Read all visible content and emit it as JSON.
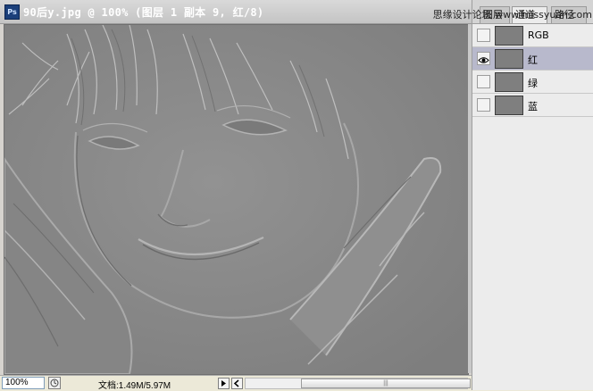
{
  "document": {
    "title": "90后y.jpg @ 100% (图层 1 副本 9, 红/8)",
    "app_icon_label": "Ps"
  },
  "status_bar": {
    "zoom": "100%",
    "doc_info": "文档:1.49M/5.97M"
  },
  "panel": {
    "watermark": "思缘设计论坛 www.missyuan.com",
    "tabs": [
      {
        "label": "图层",
        "active": false
      },
      {
        "label": "通道",
        "active": true
      },
      {
        "label": "路径",
        "active": false
      }
    ],
    "channels": [
      {
        "label": "RGB",
        "visible": false,
        "selected": false
      },
      {
        "label": "红",
        "visible": true,
        "selected": true
      },
      {
        "label": "绿",
        "visible": false,
        "selected": false
      },
      {
        "label": "蓝",
        "visible": false,
        "selected": false
      }
    ]
  },
  "colors": {
    "canvas_gray": "#8b8b8b",
    "selected_row": "#b8b9cc"
  }
}
